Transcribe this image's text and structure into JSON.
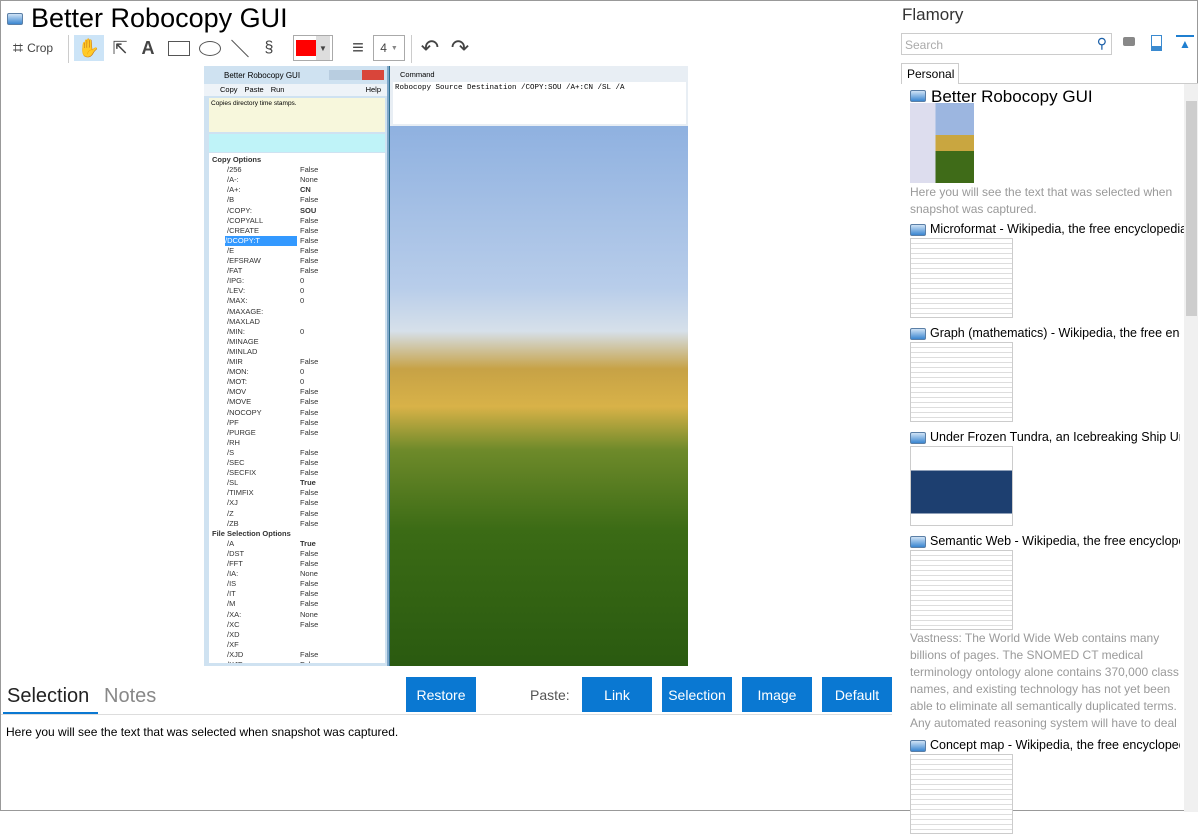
{
  "header": {
    "title": "Better Robocopy GUI"
  },
  "toolbar": {
    "crop": "Crop",
    "line_width": "4",
    "color": "#ff0000"
  },
  "snapshot": {
    "app_title": "Better Robocopy GUI",
    "menu": [
      "Copy",
      "Paste",
      "Run"
    ],
    "help": "Help",
    "description": "Copies directory time stamps.",
    "command_title": "Command",
    "command": "Robocopy Source Destination  /COPY:SOU /A+:CN /SL /A",
    "group1": "Copy Options",
    "props1": [
      [
        "/256",
        "False"
      ],
      [
        "/A-:",
        "None"
      ],
      [
        "/A+:",
        "CN"
      ],
      [
        "/B",
        "False"
      ],
      [
        "/COPY:",
        "SOU"
      ],
      [
        "/COPYALL",
        "False"
      ],
      [
        "/CREATE",
        "False"
      ],
      [
        "/DCOPY:T",
        "False"
      ],
      [
        "/E",
        "False"
      ],
      [
        "/EFSRAW",
        "False"
      ],
      [
        "/FAT",
        "False"
      ],
      [
        "/IPG:",
        "0"
      ],
      [
        "/LEV:",
        "0"
      ],
      [
        "/MAX:",
        "0"
      ],
      [
        "/MAXAGE:",
        ""
      ],
      [
        "/MAXLAD",
        ""
      ],
      [
        "/MIN:",
        "0"
      ],
      [
        "/MINAGE",
        ""
      ],
      [
        "/MINLAD",
        ""
      ],
      [
        "/MIR",
        "False"
      ],
      [
        "/MON:",
        "0"
      ],
      [
        "/MOT:",
        "0"
      ],
      [
        "/MOV",
        "False"
      ],
      [
        "/MOVE",
        "False"
      ],
      [
        "/NOCOPY",
        "False"
      ],
      [
        "/PF",
        "False"
      ],
      [
        "/PURGE",
        "False"
      ],
      [
        "/RH",
        ""
      ],
      [
        "/S",
        "False"
      ],
      [
        "/SEC",
        "False"
      ],
      [
        "/SECFIX",
        "False"
      ],
      [
        "/SL",
        "True"
      ],
      [
        "/TIMFIX",
        "False"
      ],
      [
        "/XJ",
        "False"
      ],
      [
        "/Z",
        "False"
      ],
      [
        "/ZB",
        "False"
      ]
    ],
    "group2": "File Selection Options",
    "props2": [
      [
        "/A",
        "True"
      ],
      [
        "/DST",
        "False"
      ],
      [
        "/FFT",
        "False"
      ],
      [
        "/IA:",
        "None"
      ],
      [
        "/IS",
        "False"
      ],
      [
        "/IT",
        "False"
      ],
      [
        "/M",
        "False"
      ],
      [
        "/XA:",
        "None"
      ],
      [
        "/XC",
        "False"
      ],
      [
        "/XD",
        ""
      ],
      [
        "/XF",
        ""
      ],
      [
        "/XJD",
        "False"
      ],
      [
        "/XJF",
        "False"
      ]
    ]
  },
  "bottom": {
    "tabs": [
      "Selection",
      "Notes"
    ],
    "restore": "Restore",
    "paste_label": "Paste:",
    "paste_buttons": [
      "Link",
      "Selection",
      "Image",
      "Default"
    ],
    "text": "Here you will see the text that was selected when snapshot was captured."
  },
  "flamory": {
    "title": "Flamory",
    "search_placeholder": "Search",
    "tab": "Personal",
    "items": [
      {
        "title": "Better Robocopy GUI",
        "desc": "Here you will see the text that was selected when snapshot was captured."
      },
      {
        "title": "Microformat - Wikipedia, the free encyclopedia"
      },
      {
        "title": "Graph (mathematics) - Wikipedia, the free encyclopedia"
      },
      {
        "title": "Under Frozen Tundra, an Icebreaking Ship Uncovers"
      },
      {
        "title": "Semantic Web - Wikipedia, the free encyclopedia",
        "desc": "Vastness: The World Wide Web contains many billions of pages. The SNOMED CT medical terminology ontology alone contains 370,000 class names, and existing technology has not yet been able to eliminate all semantically duplicated terms. Any automated reasoning system will have to deal with truly huge inputs."
      },
      {
        "title": "Concept map - Wikipedia, the free encyclopedia"
      }
    ]
  }
}
